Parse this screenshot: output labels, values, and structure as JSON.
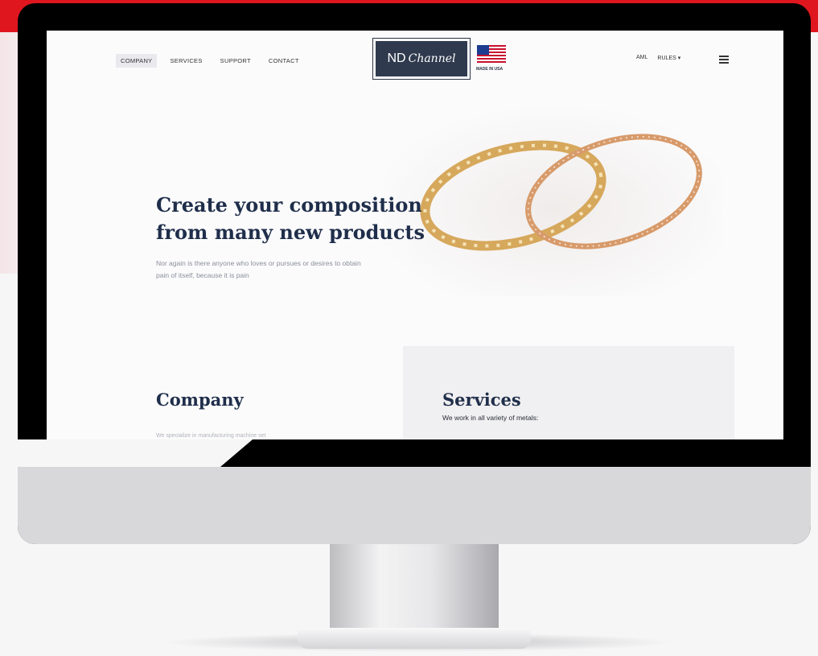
{
  "nav": {
    "left": [
      "COMPANY",
      "SERVICES",
      "SUPPORT",
      "CONTACT"
    ],
    "active_index": 0,
    "right": [
      "AML",
      "RULES ▾"
    ]
  },
  "logo": {
    "nd": "ND",
    "channel": "Channel",
    "made": "MADE IN USA"
  },
  "hero": {
    "title_line1": "Create your composition",
    "title_line2": "from many new products",
    "desc": "Nor again is there anyone who loves or pursues or desires to obtain pain of itself, because it is pain"
  },
  "sections": {
    "company_title": "Company",
    "company_text": "We specialize in manufacturing machine set",
    "services_title": "Services",
    "services_sub": "We work in all variety of metals:"
  },
  "colors": {
    "brand_red": "#e0161f",
    "navy": "#1f2e4a"
  }
}
